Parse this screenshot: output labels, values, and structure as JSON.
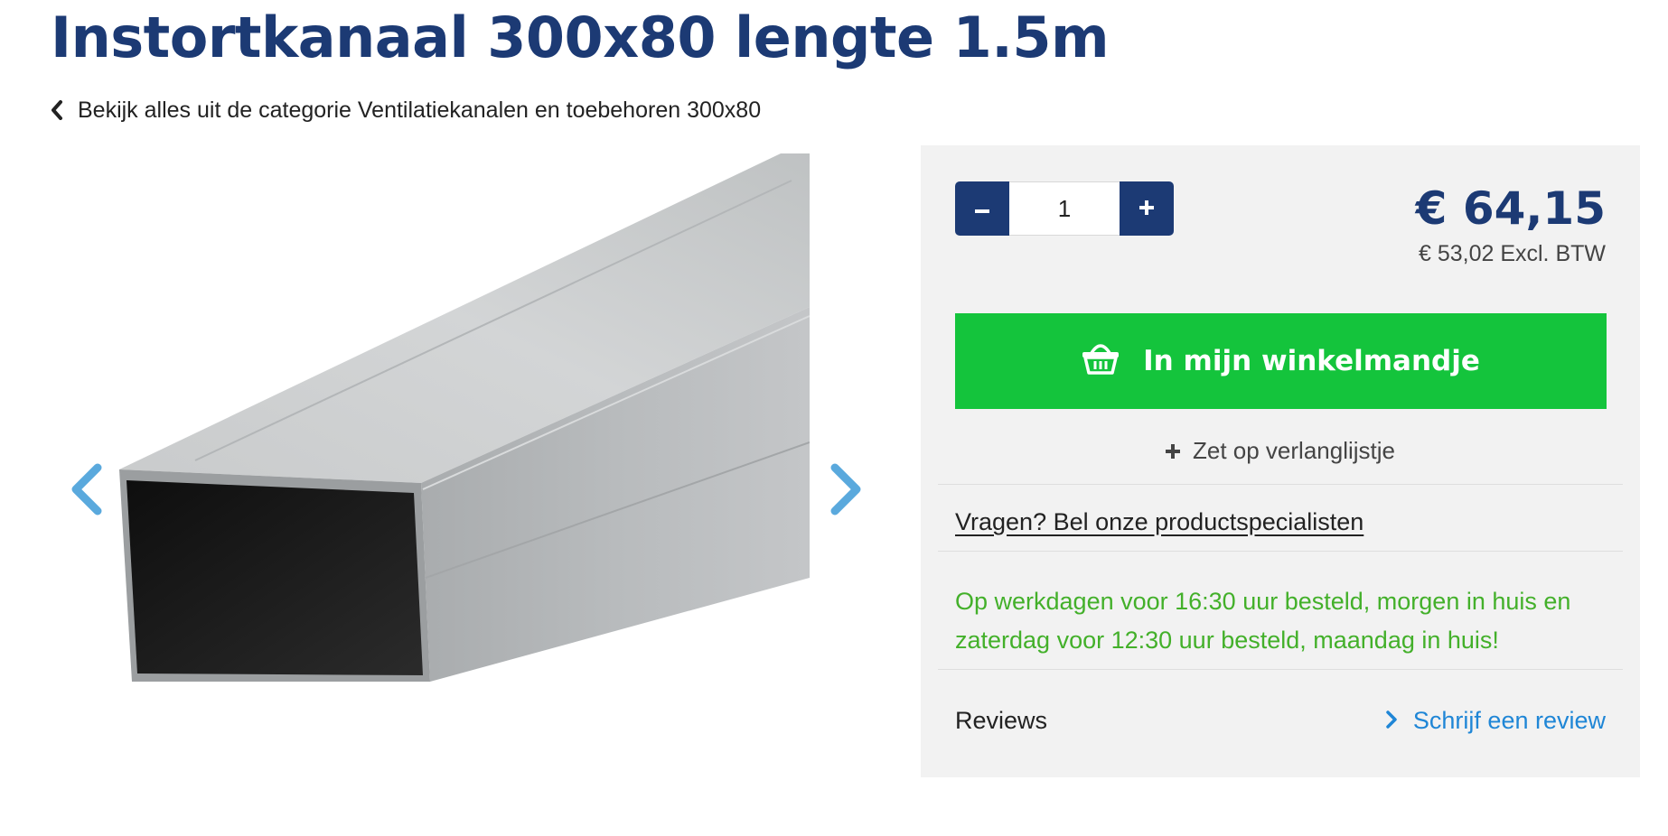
{
  "product": {
    "title": "Instortkanaal 300x80 lengte 1.5m",
    "back_link": "Bekijk alles uit de categorie Ventilatiekanalen en toebehoren 300x80"
  },
  "gallery": {
    "image": "galvanized-rectangular-duct",
    "prev_icon": "chevron-left-icon",
    "next_icon": "chevron-right-icon",
    "arrow_color": "#5aa9dd"
  },
  "purchase": {
    "quantity": "1",
    "minus_label": "−",
    "plus_label": "+",
    "price": "€ 64,15",
    "price_excl": "€ 53,02 Excl. BTW",
    "add_to_cart": "In mijn winkelmandje",
    "wishlist": "Zet op verlanglijstje",
    "questions": "Vragen? Bel onze productspecialisten",
    "delivery": "Op werkdagen voor 16:30 uur besteld, morgen in huis en zaterdag voor 12:30 uur besteld, maandag in huis!",
    "reviews_label": "Reviews",
    "write_review": "Schrijf een review"
  },
  "colors": {
    "brand_navy": "#1c3a74",
    "cart_green": "#14c43c",
    "delivery_green": "#43b02a",
    "link_blue": "#1f86d6",
    "panel_bg": "#f2f2f2"
  }
}
